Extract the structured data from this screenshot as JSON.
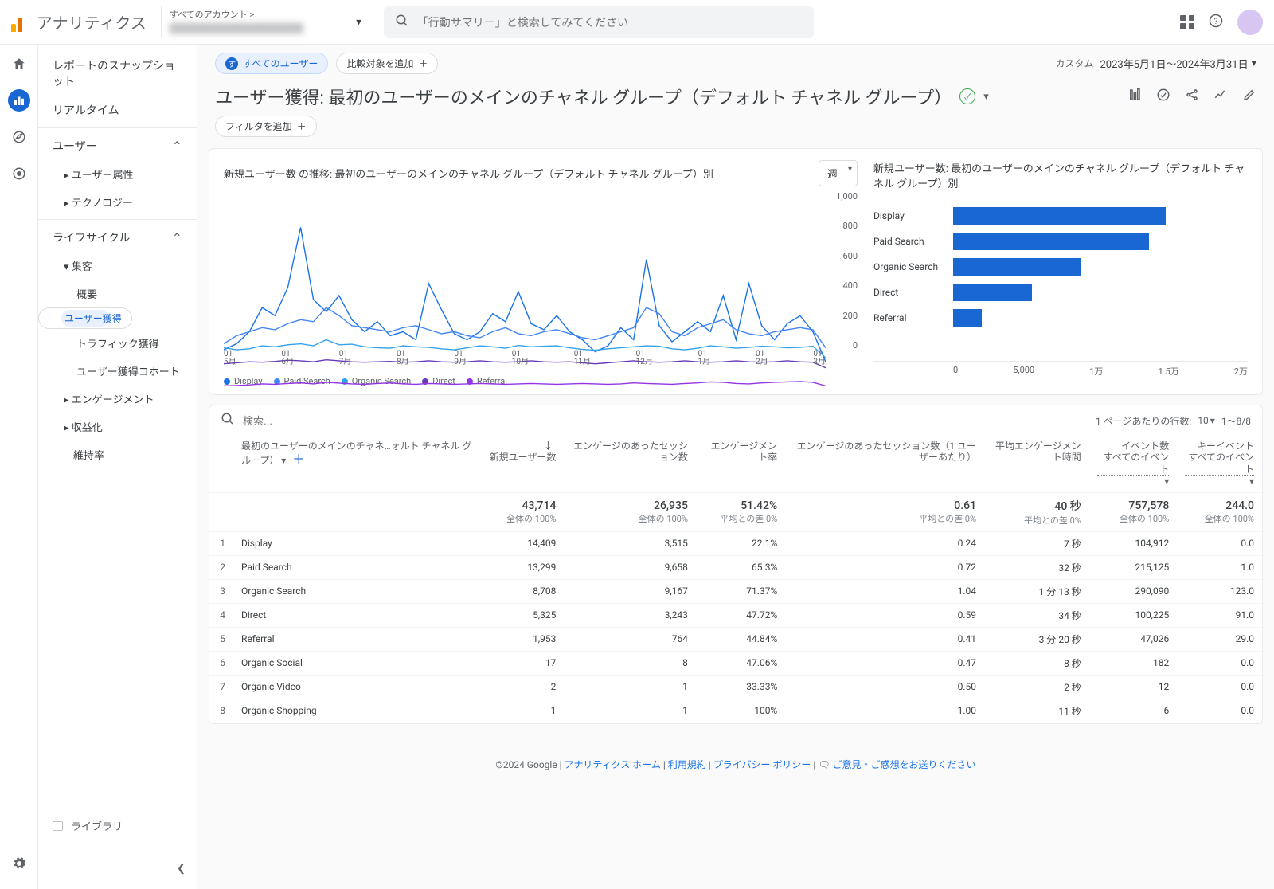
{
  "header": {
    "app_name": "アナリティクス",
    "account_top": "すべてのアカウント >",
    "search_placeholder": "「行動サマリー」と検索してみてください"
  },
  "nav": {
    "snapshot": "レポートのスナップショット",
    "realtime": "リアルタイム",
    "user_section": "ユーザー",
    "user_attr": "ユーザー属性",
    "technology": "テクノロジー",
    "lifecycle_section": "ライフサイクル",
    "acquisition": "集客",
    "overview": "概要",
    "user_acq": "ユーザー獲得",
    "traffic_acq": "トラフィック獲得",
    "user_acq_cohort": "ユーザー獲得コホート",
    "engagement": "エンゲージメント",
    "monetization": "収益化",
    "retention": "維持率",
    "library": "ライブラリ"
  },
  "topbar": {
    "all_users_badge": "す",
    "all_users": "すべてのユーザー",
    "add_compare": "比較対象を追加",
    "custom": "カスタム",
    "date_range": "2023年5月1日～2024年3月31日"
  },
  "title": "ユーザー獲得: 最初のユーザーのメインのチャネル グループ（デフォルト チャネル グループ）",
  "add_filter": "フィルタを追加",
  "line_chart_title": "新規ユーザー数 の推移: 最初のユーザーのメインのチャネル グループ（デフォルト チャネル グループ）別",
  "granularity": "週",
  "bar_chart_title": "新規ユーザー数: 最初のユーザーのメインのチャネル グループ（デフォルト チャネル グループ）別",
  "legend": [
    "Display",
    "Paid Search",
    "Organic Search",
    "Direct",
    "Referral"
  ],
  "legend_colors": [
    "#1a73e8",
    "#4285f4",
    "#34a1eb",
    "#673ab7",
    "#9334e6"
  ],
  "y_labels": [
    "1,000",
    "800",
    "600",
    "400",
    "200",
    "0"
  ],
  "x_labels": [
    [
      "01",
      "5月"
    ],
    [
      "01",
      "6月"
    ],
    [
      "01",
      "7月"
    ],
    [
      "01",
      "8月"
    ],
    [
      "01",
      "9月"
    ],
    [
      "01",
      "10月"
    ],
    [
      "01",
      "11月"
    ],
    [
      "01",
      "12月"
    ],
    [
      "01",
      "1月"
    ],
    [
      "01",
      "2月"
    ],
    [
      "01",
      "3月"
    ]
  ],
  "bar_x_labels": [
    "0",
    "5,000",
    "1万",
    "1.5万",
    "2万"
  ],
  "search_label": "検索...",
  "rows_per_page_label": "1 ページあたりの行数:",
  "rows_per_page": "10",
  "page_range": "1～8/8",
  "columns": {
    "dim": "最初のユーザーのメインのチャネ…ォルト チャネル グループ）",
    "new_users": "新規ユーザー数",
    "eng_sessions": "エンゲージのあったセッション数",
    "eng_rate": "エンゲージメント率",
    "eng_per_user": "エンゲージのあったセッション数（1 ユーザーあたり）",
    "avg_eng_time": "平均エンゲージメント時間",
    "events": "イベント数",
    "all_events": "すべてのイベント",
    "key_events": "キーイベント"
  },
  "summary": {
    "new_users": "43,714",
    "eng_sessions": "26,935",
    "eng_rate": "51.42%",
    "eng_per_user": "0.61",
    "avg_eng_time": "40 秒",
    "events": "757,578",
    "key_events": "244.0",
    "sub_100": "全体の 100%",
    "sub_avg0": "平均との差 0%"
  },
  "rows": [
    {
      "n": "1",
      "dim": "Display",
      "new_users": "14,409",
      "eng_sessions": "3,515",
      "eng_rate": "22.1%",
      "eng_per_user": "0.24",
      "avg_eng_time": "7 秒",
      "events": "104,912",
      "key_events": "0.0"
    },
    {
      "n": "2",
      "dim": "Paid Search",
      "new_users": "13,299",
      "eng_sessions": "9,658",
      "eng_rate": "65.3%",
      "eng_per_user": "0.72",
      "avg_eng_time": "32 秒",
      "events": "215,125",
      "key_events": "1.0"
    },
    {
      "n": "3",
      "dim": "Organic Search",
      "new_users": "8,708",
      "eng_sessions": "9,167",
      "eng_rate": "71.37%",
      "eng_per_user": "1.04",
      "avg_eng_time": "1 分 13 秒",
      "events": "290,090",
      "key_events": "123.0"
    },
    {
      "n": "4",
      "dim": "Direct",
      "new_users": "5,325",
      "eng_sessions": "3,243",
      "eng_rate": "47.72%",
      "eng_per_user": "0.59",
      "avg_eng_time": "34 秒",
      "events": "100,225",
      "key_events": "91.0"
    },
    {
      "n": "5",
      "dim": "Referral",
      "new_users": "1,953",
      "eng_sessions": "764",
      "eng_rate": "44.84%",
      "eng_per_user": "0.41",
      "avg_eng_time": "3 分 20 秒",
      "events": "47,026",
      "key_events": "29.0"
    },
    {
      "n": "6",
      "dim": "Organic Social",
      "new_users": "17",
      "eng_sessions": "8",
      "eng_rate": "47.06%",
      "eng_per_user": "0.47",
      "avg_eng_time": "8 秒",
      "events": "182",
      "key_events": "0.0"
    },
    {
      "n": "7",
      "dim": "Organic Video",
      "new_users": "2",
      "eng_sessions": "1",
      "eng_rate": "33.33%",
      "eng_per_user": "0.50",
      "avg_eng_time": "2 秒",
      "events": "12",
      "key_events": "0.0"
    },
    {
      "n": "8",
      "dim": "Organic Shopping",
      "new_users": "1",
      "eng_sessions": "1",
      "eng_rate": "100%",
      "eng_per_user": "1.00",
      "avg_eng_time": "11 秒",
      "events": "6",
      "key_events": "0.0"
    }
  ],
  "footer": {
    "copyright": "©2024 Google",
    "home": "アナリティクス ホーム",
    "terms": "利用規約",
    "privacy": "プライバシー ポリシー",
    "feedback": "ご意見・ご感想をお送りください"
  },
  "chart_data": {
    "line": {
      "type": "line",
      "title": "新規ユーザー数 の推移",
      "ylabel": "新規ユーザー数",
      "ylim": [
        0,
        1000
      ],
      "x_weeks": 48,
      "series": [
        {
          "name": "Display",
          "color": "#1a73e8",
          "values": [
            210,
            240,
            300,
            420,
            380,
            520,
            820,
            460,
            400,
            480,
            360,
            300,
            350,
            280,
            300,
            260,
            540,
            410,
            290,
            260,
            300,
            390,
            350,
            500,
            340,
            310,
            380,
            300,
            260,
            200,
            230,
            320,
            260,
            660,
            330,
            250,
            300,
            350,
            300,
            480,
            260,
            540,
            330,
            260,
            340,
            380,
            300,
            150
          ]
        },
        {
          "name": "Paid Search",
          "color": "#4285f4",
          "values": [
            240,
            280,
            300,
            320,
            310,
            340,
            360,
            350,
            420,
            380,
            330,
            320,
            310,
            300,
            320,
            330,
            310,
            290,
            300,
            280,
            270,
            300,
            320,
            290,
            280,
            300,
            310,
            290,
            270,
            260,
            280,
            300,
            320,
            420,
            390,
            300,
            280,
            320,
            340,
            360,
            310,
            290,
            280,
            300,
            310,
            320,
            310,
            220
          ]
        },
        {
          "name": "Organic Search",
          "color": "#34a1eb",
          "values": [
            220,
            210,
            215,
            230,
            225,
            235,
            240,
            230,
            260,
            235,
            238,
            225,
            220,
            218,
            230,
            225,
            222,
            215,
            210,
            220,
            230,
            225,
            218,
            232,
            225,
            228,
            230,
            220,
            212,
            208,
            215,
            220,
            225,
            230,
            228,
            215,
            210,
            218,
            230,
            225,
            218,
            222,
            228,
            225,
            220,
            222,
            228,
            170
          ]
        },
        {
          "name": "Direct",
          "color": "#673ab7",
          "values": [
            140,
            145,
            150,
            148,
            152,
            158,
            155,
            150,
            160,
            155,
            150,
            148,
            150,
            152,
            148,
            150,
            155,
            150,
            148,
            150,
            155,
            150,
            148,
            150,
            155,
            150,
            148,
            150,
            145,
            140,
            145,
            150,
            155,
            150,
            148,
            150,
            155,
            150,
            148,
            150,
            155,
            150,
            148,
            150,
            155,
            150,
            148,
            120
          ]
        },
        {
          "name": "Referral",
          "color": "#9334e6",
          "values": [
            30,
            32,
            35,
            40,
            38,
            42,
            45,
            40,
            48,
            44,
            40,
            38,
            42,
            45,
            40,
            38,
            42,
            40,
            38,
            40,
            42,
            40,
            38,
            40,
            42,
            40,
            38,
            40,
            42,
            40,
            38,
            40,
            45,
            42,
            40,
            38,
            42,
            45,
            50,
            48,
            42,
            40,
            45,
            48,
            50,
            52,
            48,
            30
          ]
        }
      ]
    },
    "bar": {
      "type": "bar",
      "title": "新規ユーザー数",
      "xlim": [
        0,
        20000
      ],
      "categories": [
        "Display",
        "Paid Search",
        "Organic Search",
        "Direct",
        "Referral"
      ],
      "values": [
        14409,
        13299,
        8708,
        5325,
        1953
      ]
    }
  }
}
